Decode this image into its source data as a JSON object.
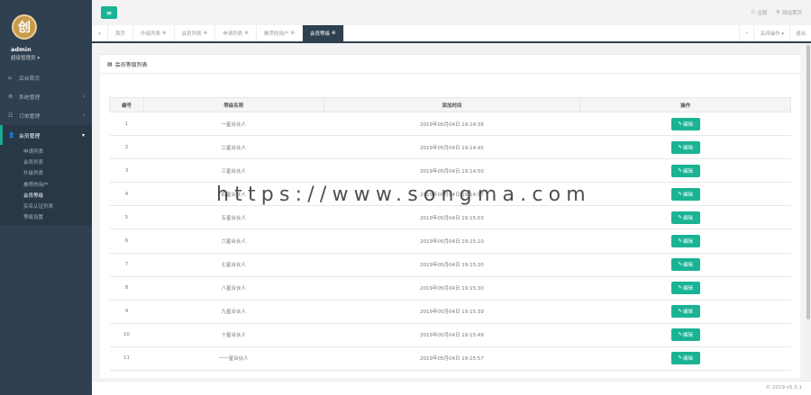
{
  "profile": {
    "logo_char": "创",
    "username": "admin",
    "role": "超级管理员 ▾"
  },
  "sidebar": {
    "items": [
      {
        "icon": "⌂",
        "label": "后台首页",
        "arrow": ""
      },
      {
        "icon": "⚙",
        "label": "系统管理",
        "arrow": "‹"
      },
      {
        "icon": "☷",
        "label": "订单管理",
        "arrow": "‹"
      },
      {
        "icon": "👤",
        "label": "会员管理",
        "arrow": "▾"
      }
    ],
    "submenu": [
      "申请列表",
      "会员列表",
      "升级列表",
      "推荐的用户",
      "会员等级",
      "实名认证列表",
      "等级设置"
    ]
  },
  "header": {
    "menu_icon": "≡",
    "logout_label": "注销",
    "fullscreen_label": "网站首页"
  },
  "tabs": {
    "prev": "«",
    "items": [
      {
        "label": "首页",
        "close": ""
      },
      {
        "label": "升级列表",
        "close": "⊗"
      },
      {
        "label": "会员列表",
        "close": "⊗"
      },
      {
        "label": "申请列表",
        "close": "⊗"
      },
      {
        "label": "推荐的用户",
        "close": "⊗"
      },
      {
        "label": "会员等级",
        "close": "⊗"
      }
    ],
    "next": "»",
    "right_actions": [
      "关闭操作 ▾",
      "退出"
    ]
  },
  "panel": {
    "title": "会员等级列表"
  },
  "table": {
    "headers": [
      "编号",
      "等级名称",
      "添加时间",
      "操作"
    ],
    "edit_label": "编辑",
    "rows": [
      [
        "1",
        "一星合伙人",
        "2019年05月04日 19:14:38"
      ],
      [
        "2",
        "二星合伙人",
        "2019年05月04日 19:14:45"
      ],
      [
        "3",
        "三星合伙人",
        "2019年05月04日 19:14:50"
      ],
      [
        "4",
        "四星合伙人",
        "2019年05月04日 19:14:57"
      ],
      [
        "5",
        "五星合伙人",
        "2019年05月04日 19:15:03"
      ],
      [
        "6",
        "六星合伙人",
        "2019年05月04日 19:15:10"
      ],
      [
        "7",
        "七星合伙人",
        "2019年05月04日 19:15:20"
      ],
      [
        "8",
        "八星合伙人",
        "2019年05月04日 19:15:30"
      ],
      [
        "9",
        "九星合伙人",
        "2019年05月04日 19:15:39"
      ],
      [
        "10",
        "十星合伙人",
        "2019年05月04日 19:15:49"
      ],
      [
        "11",
        "一一星合伙人",
        "2019年05月04日 19:15:57"
      ]
    ]
  },
  "footer": {
    "copyright": "© 2019 v5.0.1"
  },
  "watermark": "https://www.songma.com"
}
